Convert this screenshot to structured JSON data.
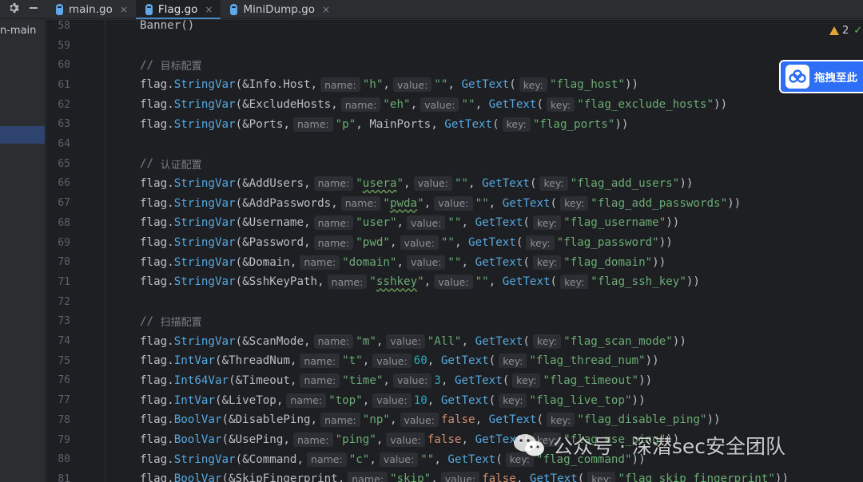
{
  "toolbar": {
    "settings_icon": "gear-icon",
    "hide_icon": "minus-icon"
  },
  "tabs": [
    {
      "label": "main.go",
      "active": false,
      "close": "×"
    },
    {
      "label": "Flag.go",
      "active": true,
      "close": "×"
    },
    {
      "label": "MiniDump.go",
      "active": false,
      "close": "×"
    }
  ],
  "project_panel": {
    "label": "n-main"
  },
  "inspection": {
    "warning_count": "2"
  },
  "float_button": {
    "label": "拖拽至此"
  },
  "watermark": {
    "text": "公众号 · 深潜sec安全团队"
  },
  "colors": {
    "function": "#55a8e0",
    "string": "#6aab73",
    "number": "#2aacb8",
    "keyword": "#cf8e6d",
    "comment": "#7a7e85",
    "accent": "#2d6ef6"
  },
  "code_lines": [
    {
      "n": "58",
      "tokens": [
        [
          "plain",
          "Banner()"
        ]
      ]
    },
    {
      "n": "59",
      "tokens": []
    },
    {
      "n": "60",
      "tokens": [
        [
          "cmt",
          "// "
        ],
        [
          "cmtcn",
          "目标配置"
        ]
      ]
    },
    {
      "n": "61",
      "tokens": [
        [
          "pkg",
          "flag."
        ],
        [
          "fn",
          "StringVar"
        ],
        [
          "plain",
          "(&Info.Host,"
        ],
        [
          "hint",
          "name:"
        ],
        [
          "str",
          "\"h\""
        ],
        [
          "plain",
          ","
        ],
        [
          "hint",
          "value:"
        ],
        [
          "str",
          "\"\""
        ],
        [
          "plain",
          ", "
        ],
        [
          "fn",
          "GetText"
        ],
        [
          "plain",
          "("
        ],
        [
          "hint",
          "key:"
        ],
        [
          "str",
          "\"flag_host\""
        ],
        [
          "plain",
          "))"
        ]
      ]
    },
    {
      "n": "62",
      "tokens": [
        [
          "pkg",
          "flag."
        ],
        [
          "fn",
          "StringVar"
        ],
        [
          "plain",
          "(&ExcludeHosts,"
        ],
        [
          "hint",
          "name:"
        ],
        [
          "str",
          "\"eh\""
        ],
        [
          "plain",
          ","
        ],
        [
          "hint",
          "value:"
        ],
        [
          "str",
          "\"\""
        ],
        [
          "plain",
          ", "
        ],
        [
          "fn",
          "GetText"
        ],
        [
          "plain",
          "("
        ],
        [
          "hint",
          "key:"
        ],
        [
          "str",
          "\"flag_exclude_hosts\""
        ],
        [
          "plain",
          "))"
        ]
      ]
    },
    {
      "n": "63",
      "tokens": [
        [
          "pkg",
          "flag."
        ],
        [
          "fn",
          "StringVar"
        ],
        [
          "plain",
          "(&Ports,"
        ],
        [
          "hint",
          "name:"
        ],
        [
          "str",
          "\"p\""
        ],
        [
          "plain",
          ", MainPorts, "
        ],
        [
          "fn",
          "GetText"
        ],
        [
          "plain",
          "("
        ],
        [
          "hint",
          "key:"
        ],
        [
          "str",
          "\"flag_ports\""
        ],
        [
          "plain",
          "))"
        ]
      ]
    },
    {
      "n": "64",
      "tokens": []
    },
    {
      "n": "65",
      "tokens": [
        [
          "cmt",
          "// "
        ],
        [
          "cmtcn",
          "认证配置"
        ]
      ]
    },
    {
      "n": "66",
      "tokens": [
        [
          "pkg",
          "flag."
        ],
        [
          "fn",
          "StringVar"
        ],
        [
          "plain",
          "(&AddUsers,"
        ],
        [
          "hint",
          "name:"
        ],
        [
          "str",
          "\""
        ],
        [
          "strsq",
          "usera"
        ],
        [
          "str",
          "\""
        ],
        [
          "plain",
          ","
        ],
        [
          "hint",
          "value:"
        ],
        [
          "str",
          "\"\""
        ],
        [
          "plain",
          ", "
        ],
        [
          "fn",
          "GetText"
        ],
        [
          "plain",
          "("
        ],
        [
          "hint",
          "key:"
        ],
        [
          "str",
          "\"flag_add_users\""
        ],
        [
          "plain",
          "))"
        ]
      ]
    },
    {
      "n": "67",
      "tokens": [
        [
          "pkg",
          "flag."
        ],
        [
          "fn",
          "StringVar"
        ],
        [
          "plain",
          "(&AddPasswords,"
        ],
        [
          "hint",
          "name:"
        ],
        [
          "str",
          "\""
        ],
        [
          "strsq",
          "pwda"
        ],
        [
          "str",
          "\""
        ],
        [
          "plain",
          ","
        ],
        [
          "hint",
          "value:"
        ],
        [
          "str",
          "\"\""
        ],
        [
          "plain",
          ", "
        ],
        [
          "fn",
          "GetText"
        ],
        [
          "plain",
          "("
        ],
        [
          "hint",
          "key:"
        ],
        [
          "str",
          "\"flag_add_passwords\""
        ],
        [
          "plain",
          "))"
        ]
      ]
    },
    {
      "n": "68",
      "tokens": [
        [
          "pkg",
          "flag."
        ],
        [
          "fn",
          "StringVar"
        ],
        [
          "plain",
          "(&Username,"
        ],
        [
          "hint",
          "name:"
        ],
        [
          "str",
          "\"user\""
        ],
        [
          "plain",
          ","
        ],
        [
          "hint",
          "value:"
        ],
        [
          "str",
          "\"\""
        ],
        [
          "plain",
          ", "
        ],
        [
          "fn",
          "GetText"
        ],
        [
          "plain",
          "("
        ],
        [
          "hint",
          "key:"
        ],
        [
          "str",
          "\"flag_username\""
        ],
        [
          "plain",
          "))"
        ]
      ]
    },
    {
      "n": "69",
      "tokens": [
        [
          "pkg",
          "flag."
        ],
        [
          "fn",
          "StringVar"
        ],
        [
          "plain",
          "(&Password,"
        ],
        [
          "hint",
          "name:"
        ],
        [
          "str",
          "\"pwd\""
        ],
        [
          "plain",
          ","
        ],
        [
          "hint",
          "value:"
        ],
        [
          "str",
          "\"\""
        ],
        [
          "plain",
          ", "
        ],
        [
          "fn",
          "GetText"
        ],
        [
          "plain",
          "("
        ],
        [
          "hint",
          "key:"
        ],
        [
          "str",
          "\"flag_password\""
        ],
        [
          "plain",
          "))"
        ]
      ]
    },
    {
      "n": "70",
      "tokens": [
        [
          "pkg",
          "flag."
        ],
        [
          "fn",
          "StringVar"
        ],
        [
          "plain",
          "(&Domain,"
        ],
        [
          "hint",
          "name:"
        ],
        [
          "str",
          "\"domain\""
        ],
        [
          "plain",
          ","
        ],
        [
          "hint",
          "value:"
        ],
        [
          "str",
          "\"\""
        ],
        [
          "plain",
          ", "
        ],
        [
          "fn",
          "GetText"
        ],
        [
          "plain",
          "("
        ],
        [
          "hint",
          "key:"
        ],
        [
          "str",
          "\"flag_domain\""
        ],
        [
          "plain",
          "))"
        ]
      ]
    },
    {
      "n": "71",
      "tokens": [
        [
          "pkg",
          "flag."
        ],
        [
          "fn",
          "StringVar"
        ],
        [
          "plain",
          "(&SshKeyPath,"
        ],
        [
          "hint",
          "name:"
        ],
        [
          "str",
          "\""
        ],
        [
          "strsq",
          "sshkey"
        ],
        [
          "str",
          "\""
        ],
        [
          "plain",
          ","
        ],
        [
          "hint",
          "value:"
        ],
        [
          "str",
          "\"\""
        ],
        [
          "plain",
          ", "
        ],
        [
          "fn",
          "GetText"
        ],
        [
          "plain",
          "("
        ],
        [
          "hint",
          "key:"
        ],
        [
          "str",
          "\"flag_ssh_key\""
        ],
        [
          "plain",
          "))"
        ]
      ]
    },
    {
      "n": "72",
      "tokens": []
    },
    {
      "n": "73",
      "tokens": [
        [
          "cmt",
          "// "
        ],
        [
          "cmtcn",
          "扫描配置"
        ]
      ]
    },
    {
      "n": "74",
      "tokens": [
        [
          "pkg",
          "flag."
        ],
        [
          "fn",
          "StringVar"
        ],
        [
          "plain",
          "(&ScanMode,"
        ],
        [
          "hint",
          "name:"
        ],
        [
          "str",
          "\"m\""
        ],
        [
          "plain",
          ","
        ],
        [
          "hint",
          "value:"
        ],
        [
          "str",
          "\"All\""
        ],
        [
          "plain",
          ", "
        ],
        [
          "fn",
          "GetText"
        ],
        [
          "plain",
          "("
        ],
        [
          "hint",
          "key:"
        ],
        [
          "str",
          "\"flag_scan_mode\""
        ],
        [
          "plain",
          "))"
        ]
      ]
    },
    {
      "n": "75",
      "tokens": [
        [
          "pkg",
          "flag."
        ],
        [
          "fn",
          "IntVar"
        ],
        [
          "plain",
          "(&ThreadNum,"
        ],
        [
          "hint",
          "name:"
        ],
        [
          "str",
          "\"t\""
        ],
        [
          "plain",
          ","
        ],
        [
          "hint",
          "value:"
        ],
        [
          "num",
          "60"
        ],
        [
          "plain",
          ", "
        ],
        [
          "fn",
          "GetText"
        ],
        [
          "plain",
          "("
        ],
        [
          "hint",
          "key:"
        ],
        [
          "str",
          "\"flag_thread_num\""
        ],
        [
          "plain",
          "))"
        ]
      ]
    },
    {
      "n": "76",
      "tokens": [
        [
          "pkg",
          "flag."
        ],
        [
          "fn",
          "Int64Var"
        ],
        [
          "plain",
          "(&Timeout,"
        ],
        [
          "hint",
          "name:"
        ],
        [
          "str",
          "\"time\""
        ],
        [
          "plain",
          ","
        ],
        [
          "hint",
          "value:"
        ],
        [
          "num",
          "3"
        ],
        [
          "plain",
          ", "
        ],
        [
          "fn",
          "GetText"
        ],
        [
          "plain",
          "("
        ],
        [
          "hint",
          "key:"
        ],
        [
          "str",
          "\"flag_timeout\""
        ],
        [
          "plain",
          "))"
        ]
      ]
    },
    {
      "n": "77",
      "tokens": [
        [
          "pkg",
          "flag."
        ],
        [
          "fn",
          "IntVar"
        ],
        [
          "plain",
          "(&LiveTop,"
        ],
        [
          "hint",
          "name:"
        ],
        [
          "str",
          "\"top\""
        ],
        [
          "plain",
          ","
        ],
        [
          "hint",
          "value:"
        ],
        [
          "num",
          "10"
        ],
        [
          "plain",
          ", "
        ],
        [
          "fn",
          "GetText"
        ],
        [
          "plain",
          "("
        ],
        [
          "hint",
          "key:"
        ],
        [
          "str",
          "\"flag_live_top\""
        ],
        [
          "plain",
          "))"
        ]
      ]
    },
    {
      "n": "78",
      "tokens": [
        [
          "pkg",
          "flag."
        ],
        [
          "fn",
          "BoolVar"
        ],
        [
          "plain",
          "(&DisablePing,"
        ],
        [
          "hint",
          "name:"
        ],
        [
          "str",
          "\"np\""
        ],
        [
          "plain",
          ","
        ],
        [
          "hint",
          "value:"
        ],
        [
          "kw",
          "false"
        ],
        [
          "plain",
          ", "
        ],
        [
          "fn",
          "GetText"
        ],
        [
          "plain",
          "("
        ],
        [
          "hint",
          "key:"
        ],
        [
          "str",
          "\"flag_disable_ping\""
        ],
        [
          "plain",
          "))"
        ]
      ]
    },
    {
      "n": "79",
      "tokens": [
        [
          "pkg",
          "flag."
        ],
        [
          "fn",
          "BoolVar"
        ],
        [
          "plain",
          "(&UsePing,"
        ],
        [
          "hint",
          "name:"
        ],
        [
          "str",
          "\"ping\""
        ],
        [
          "plain",
          ","
        ],
        [
          "hint",
          "value:"
        ],
        [
          "kw",
          "false"
        ],
        [
          "plain",
          ", "
        ],
        [
          "fn",
          "GetText"
        ],
        [
          "plain",
          "("
        ],
        [
          "hint",
          "key:"
        ],
        [
          "str",
          "\"flag_use_ping\""
        ],
        [
          "plain",
          "))"
        ]
      ]
    },
    {
      "n": "80",
      "tokens": [
        [
          "pkg",
          "flag."
        ],
        [
          "fn",
          "StringVar"
        ],
        [
          "plain",
          "(&Command,"
        ],
        [
          "hint",
          "name:"
        ],
        [
          "str",
          "\"c\""
        ],
        [
          "plain",
          ","
        ],
        [
          "hint",
          "value:"
        ],
        [
          "str",
          "\"\""
        ],
        [
          "plain",
          ", "
        ],
        [
          "fn",
          "GetText"
        ],
        [
          "plain",
          "("
        ],
        [
          "hint",
          "key:"
        ],
        [
          "str",
          "\"flag_command\""
        ],
        [
          "plain",
          "))"
        ]
      ]
    },
    {
      "n": "81",
      "tokens": [
        [
          "pkg",
          "flag."
        ],
        [
          "fn",
          "BoolVar"
        ],
        [
          "plain",
          "(&SkipFingerprint,"
        ],
        [
          "hint",
          "name:"
        ],
        [
          "str",
          "\"skip\""
        ],
        [
          "plain",
          ","
        ],
        [
          "hint",
          "value:"
        ],
        [
          "kw",
          "false"
        ],
        [
          "plain",
          ", "
        ],
        [
          "fn",
          "GetText"
        ],
        [
          "plain",
          "("
        ],
        [
          "hint",
          "key:"
        ],
        [
          "str",
          "\"flag_skip_fingerprint\""
        ],
        [
          "plain",
          "))"
        ]
      ]
    }
  ]
}
